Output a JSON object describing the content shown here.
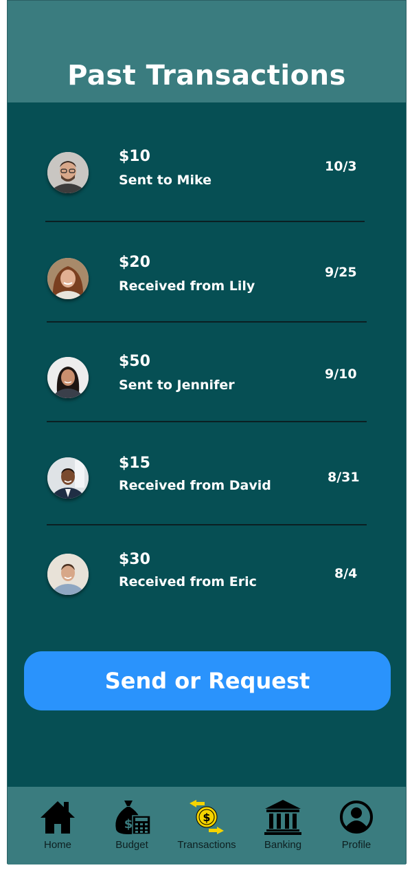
{
  "header": {
    "title": "Past Transactions"
  },
  "transactions": [
    {
      "amount": "$10",
      "description": "Sent to Mike",
      "date": "10/3"
    },
    {
      "amount": "$20",
      "description": "Received from Lily",
      "date": "9/25"
    },
    {
      "amount": "$50",
      "description": "Sent to Jennifer",
      "date": "9/10"
    },
    {
      "amount": "$15",
      "description": "Received from David",
      "date": "8/31"
    },
    {
      "amount": "$30",
      "description": "Received from Eric",
      "date": "8/4"
    }
  ],
  "cta": {
    "label": "Send or Request"
  },
  "nav": {
    "items": [
      {
        "label": "Home",
        "icon": "home-icon"
      },
      {
        "label": "Budget",
        "icon": "money-bag-calculator-icon"
      },
      {
        "label": "Transactions",
        "icon": "transfer-dollar-icon",
        "active": true
      },
      {
        "label": "Banking",
        "icon": "bank-icon"
      },
      {
        "label": "Profile",
        "icon": "profile-icon"
      }
    ]
  },
  "colors": {
    "background": "#064f54",
    "header": "#3a7c7f",
    "accent_button": "#2a93fc",
    "active_icon": "#f5d400"
  }
}
